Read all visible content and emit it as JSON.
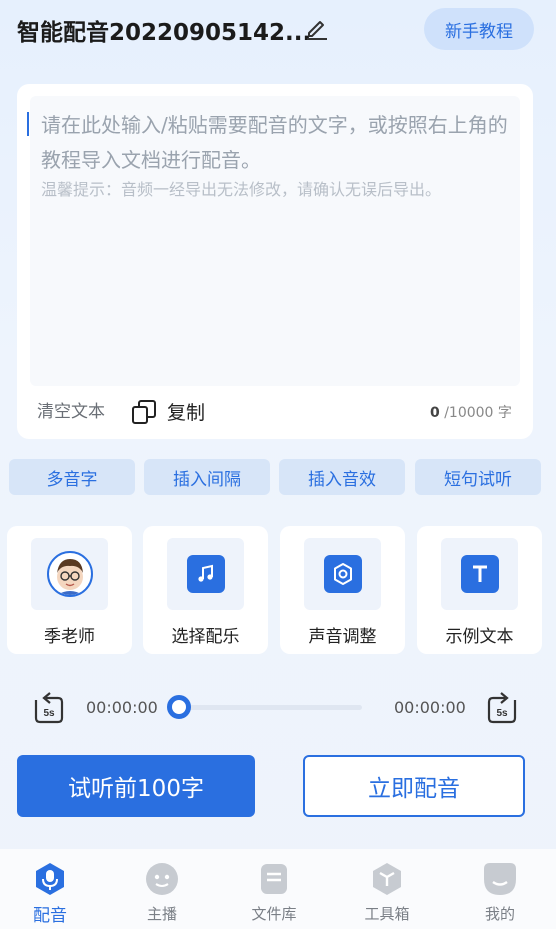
{
  "header": {
    "title": "智能配音20220905142...",
    "tutorial_label": "新手教程"
  },
  "editor": {
    "placeholder": "请在此处输入/粘贴需要配音的文字，或按照右上角的教程导入文档进行配音。",
    "tip": "温馨提示：音频一经导出无法修改，请确认无误后导出。",
    "clear_label": "清空文本",
    "copy_label": "复制",
    "char_count": "0",
    "char_limit": " /10000 字"
  },
  "tools": [
    "多音字",
    "插入间隔",
    "插入音效",
    "短句试听"
  ],
  "features": [
    {
      "label": "季老师",
      "icon": "teacher-avatar"
    },
    {
      "label": "选择配乐",
      "icon": "music-note-icon"
    },
    {
      "label": "声音调整",
      "icon": "settings-gear-icon"
    },
    {
      "label": "示例文本",
      "icon": "text-t-icon"
    }
  ],
  "player": {
    "current_time": "00:00:00",
    "total_time": "00:00:00",
    "rewind_label": "5s",
    "forward_label": "5s",
    "progress": 0
  },
  "actions": {
    "preview_label": "试听前100字",
    "dub_label": "立即配音"
  },
  "nav": [
    {
      "label": "配音",
      "icon": "microphone-icon",
      "active": true
    },
    {
      "label": "主播",
      "icon": "anchor-face-icon",
      "active": false
    },
    {
      "label": "文件库",
      "icon": "file-library-icon",
      "active": false
    },
    {
      "label": "工具箱",
      "icon": "toolbox-icon",
      "active": false
    },
    {
      "label": "我的",
      "icon": "profile-icon",
      "active": false
    }
  ],
  "colors": {
    "accent": "#2a6fe0",
    "pill_bg": "#d7e5f8",
    "background": "#eef3fb"
  }
}
